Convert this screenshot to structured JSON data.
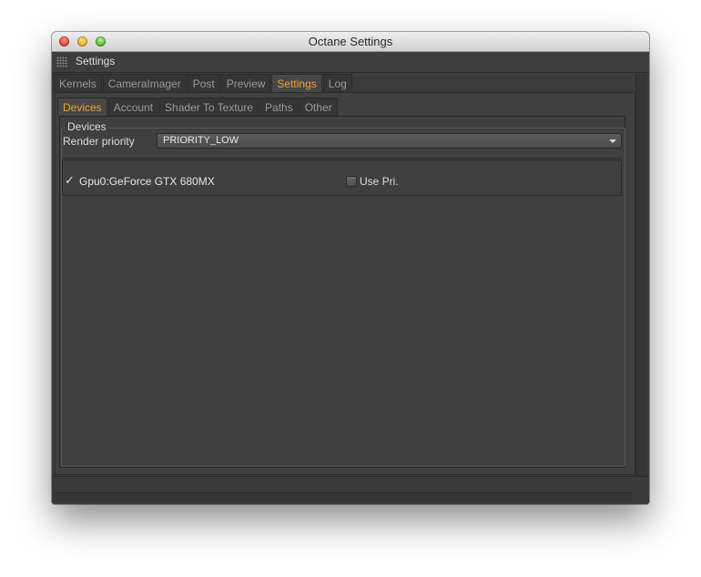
{
  "window": {
    "title": "Octane Settings"
  },
  "panel": {
    "title": "Settings"
  },
  "main_tabs": [
    {
      "label": "Kernels",
      "active": false
    },
    {
      "label": "CameraImager",
      "active": false
    },
    {
      "label": "Post",
      "active": false
    },
    {
      "label": "Preview",
      "active": false
    },
    {
      "label": "Settings",
      "active": true
    },
    {
      "label": "Log",
      "active": false
    }
  ],
  "sub_tabs": [
    {
      "label": "Devices",
      "active": true
    },
    {
      "label": "Account",
      "active": false
    },
    {
      "label": "Shader To Texture",
      "active": false
    },
    {
      "label": "Paths",
      "active": false
    },
    {
      "label": "Other",
      "active": false
    }
  ],
  "devices": {
    "group_label": "Devices",
    "render_priority_label": "Render priority",
    "render_priority_value": "PRIORITY_LOW",
    "device_check": "✓",
    "device_name": "Gpu0:GeForce GTX 680MX",
    "use_pri_label": "Use Pri.",
    "use_pri_checked": false
  },
  "colors": {
    "accent": "#f0a030",
    "background": "#404040"
  }
}
